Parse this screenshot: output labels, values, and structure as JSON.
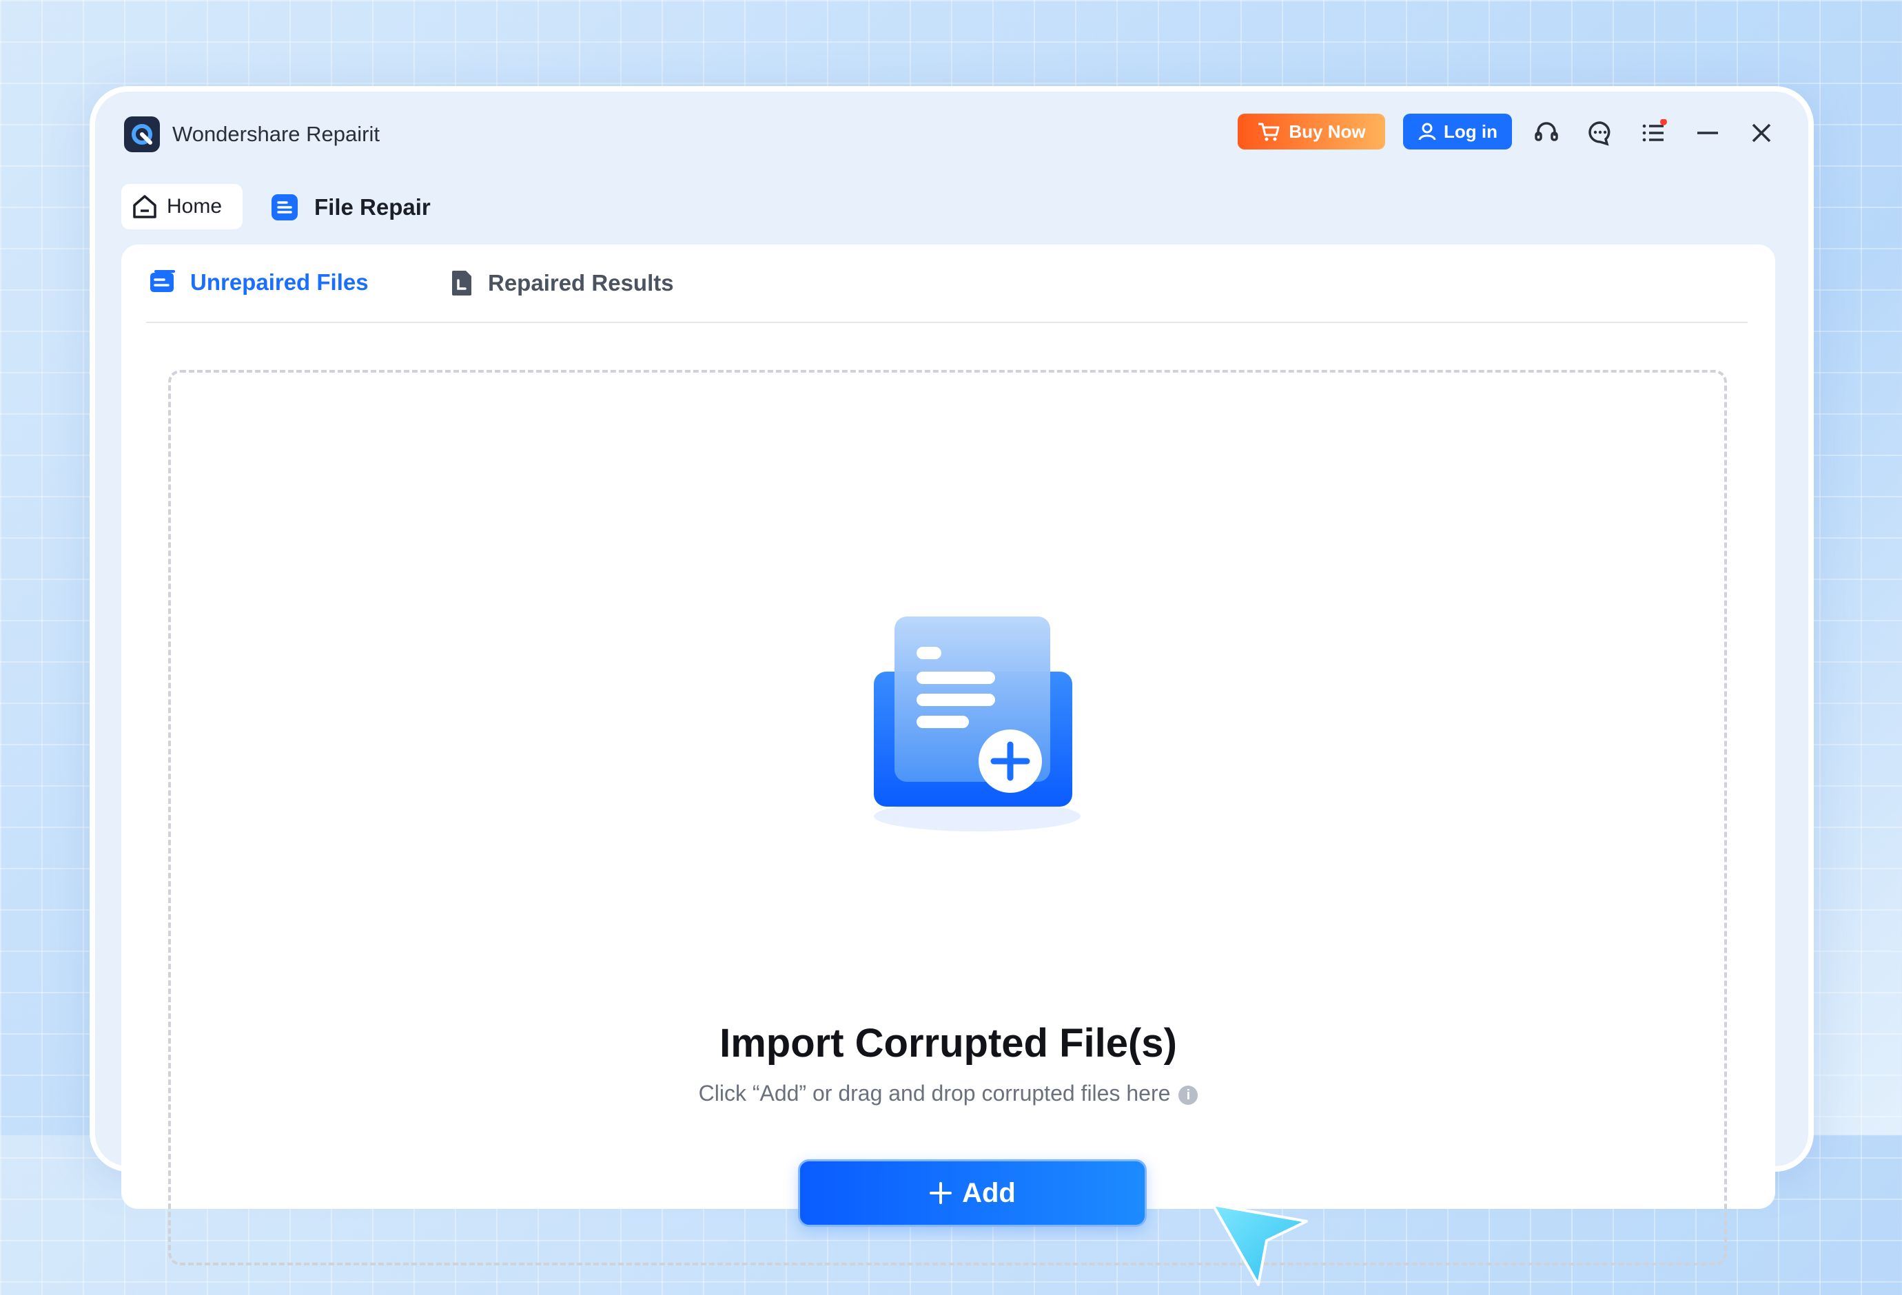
{
  "app": {
    "title": "Wondershare Repairit"
  },
  "toolbar": {
    "buy_label": "Buy Now",
    "login_label": "Log in",
    "icons": [
      "headset-icon",
      "chat-icon",
      "menu-icon",
      "minimize-icon",
      "close-icon"
    ]
  },
  "nav": {
    "home_label": "Home",
    "file_repair_label": "File Repair"
  },
  "subtabs": {
    "unrepaired": "Unrepaired Files",
    "repaired": "Repaired Results",
    "active": "unrepaired"
  },
  "dropzone": {
    "title": "Import Corrupted File(s)",
    "hint": "Click “Add” or drag and drop corrupted files here",
    "add_label": "Add"
  },
  "colors": {
    "accent": "#1a6fff",
    "buy_start": "#ff5a1a",
    "buy_end": "#ffb25a"
  }
}
